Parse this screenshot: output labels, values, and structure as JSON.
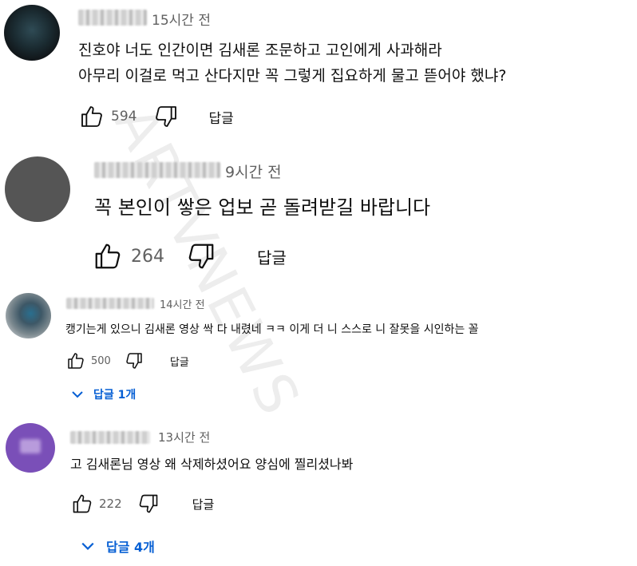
{
  "watermark": "ARTVNEWS",
  "comments": [
    {
      "time": "15시간 전",
      "text": "진호야 너도 인간이면 김새론 조문하고 고인에게 사과해라\n아무리 이걸로 먹고 산다지만 꼭 그렇게 집요하게 물고 뜯어야 했냐?",
      "likes": "594",
      "reply_label": "답글"
    },
    {
      "time": "9시간 전",
      "text": "꼭 본인이 쌓은 업보 곧 돌려받길 바랍니다",
      "likes": "264",
      "reply_label": "답글"
    },
    {
      "time": "14시간 전",
      "text": "캥기는게 있으니 김새론 영상 싹 다 내렸네 ㅋㅋ 이게 더 니 스스로 니 잘못을 시인하는 꼴",
      "likes": "500",
      "reply_label": "답글",
      "replies": "답글 1개"
    },
    {
      "time": "13시간 전",
      "text": "고 김새론님 영상 왜 삭제하셨어요 양심에 찔리셨나봐",
      "likes": "222",
      "reply_label": "답글",
      "replies": "답글 4개"
    }
  ]
}
